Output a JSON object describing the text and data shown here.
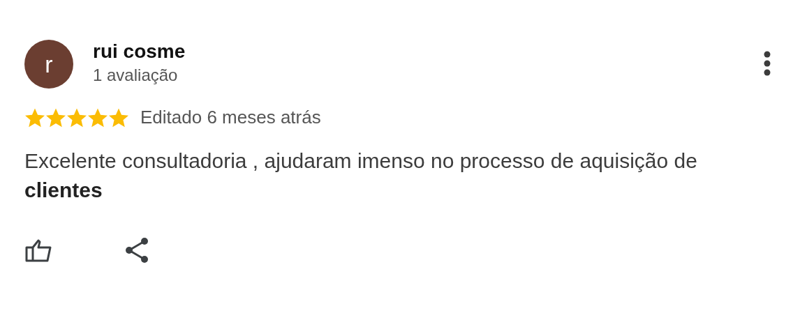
{
  "reviewer": {
    "initial": "r",
    "color": "#6b3e31",
    "name": "rui cosme",
    "review_count": "1 avaliação"
  },
  "review": {
    "stars": 5,
    "date": "Editado 6 meses atrás",
    "text": "Excelente consultadoria , ajudaram imenso no processo de aquisição de **clientes**"
  }
}
